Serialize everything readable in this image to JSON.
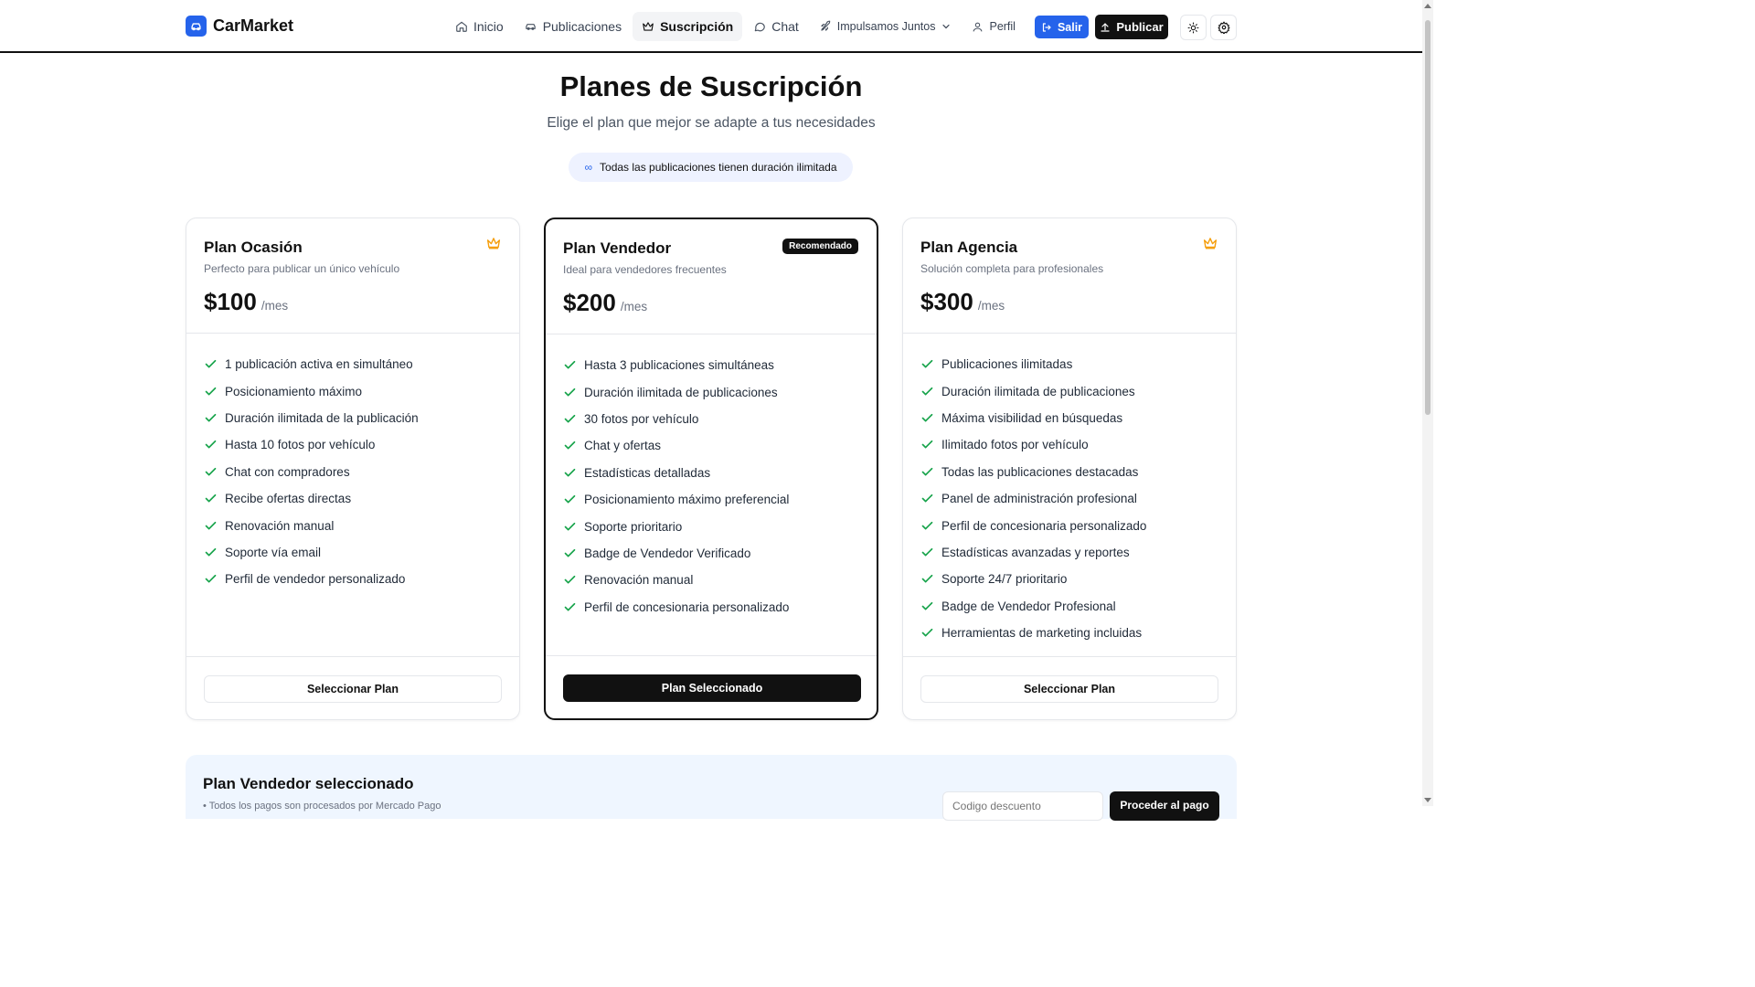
{
  "app": {
    "name": "CarMarket"
  },
  "nav": {
    "items": [
      {
        "label": "Inicio"
      },
      {
        "label": "Publicaciones"
      },
      {
        "label": "Suscripción"
      },
      {
        "label": "Chat"
      },
      {
        "label": "Impulsamos Juntos"
      },
      {
        "label": "Perfil"
      }
    ],
    "logout_label": "Salir",
    "publish_label": "Publicar"
  },
  "hero": {
    "title": "Planes de Suscripción",
    "subtitle": "Elige el plan que mejor se adapte a tus necesidades",
    "pill_icon": "∞",
    "pill_text": "Todas las publicaciones tienen duración ilimitada"
  },
  "plans": [
    {
      "name": "Plan Ocasión",
      "description": "Perfecto para publicar un único vehículo",
      "price": "$100",
      "period": "/mes",
      "icon": "crown-icon",
      "features": [
        "1 publicación activa en simultáneo",
        "Posicionamiento máximo",
        "Duración ilimitada de la publicación",
        "Hasta 10 fotos por vehículo",
        "Chat con compradores",
        "Recibe ofertas directas",
        "Renovación manual",
        "Soporte vía email",
        "Perfil de vendedor personalizado"
      ],
      "button": "Seleccionar Plan"
    },
    {
      "name": "Plan Vendedor",
      "description": "Ideal para vendedores frecuentes",
      "price": "$200",
      "period": "/mes",
      "badge": "Recomendado",
      "features": [
        "Hasta 3 publicaciones simultáneas",
        "Duración ilimitada de publicaciones",
        "30 fotos por vehículo",
        "Chat y ofertas",
        "Estadísticas detalladas",
        "Posicionamiento máximo preferencial",
        "Soporte prioritario",
        "Badge de Vendedor Verificado",
        "Renovación manual",
        "Perfil de concesionaria personalizado"
      ],
      "button": "Plan Seleccionado"
    },
    {
      "name": "Plan Agencia",
      "description": "Solución completa para profesionales",
      "price": "$300",
      "period": "/mes",
      "icon": "crown-icon",
      "features": [
        "Publicaciones ilimitadas",
        "Duración ilimitada de publicaciones",
        "Máxima visibilidad en búsquedas",
        "Ilimitado fotos por vehículo",
        "Todas las publicaciones destacadas",
        "Panel de administración profesional",
        "Perfil de concesionaria personalizado",
        "Estadísticas avanzadas y reportes",
        "Soporte 24/7 prioritario",
        "Badge de Vendedor Profesional",
        "Herramientas de marketing incluidas"
      ],
      "button": "Seleccionar Plan"
    }
  ],
  "summary": {
    "title": "Plan Vendedor seleccionado",
    "note": "• Todos los pagos son procesados por Mercado Pago",
    "discount_placeholder": "Codigo descuento",
    "pay_label": "Proceder al pago"
  },
  "colors": {
    "accent": "#2563eb",
    "check": "#16a34a",
    "crown": "#f59e0b",
    "dark": "#111111"
  }
}
